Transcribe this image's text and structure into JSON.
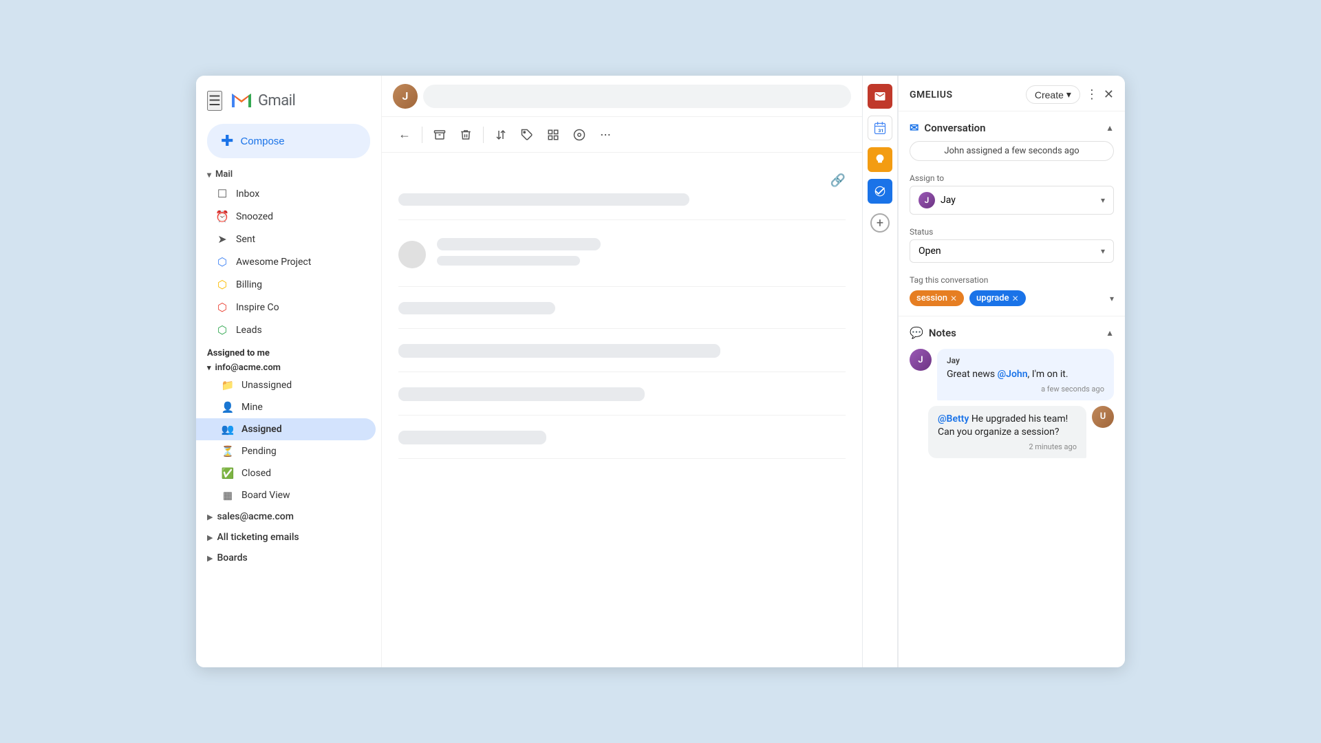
{
  "app": {
    "title": "Gmail",
    "search_placeholder": ""
  },
  "compose": {
    "label": "Compose",
    "plus": "+"
  },
  "sidebar": {
    "mail_section": "Mail",
    "mail_items": [
      {
        "id": "inbox",
        "label": "Inbox",
        "icon": "☐"
      },
      {
        "id": "snoozed",
        "label": "Snoozed",
        "icon": "🕐"
      },
      {
        "id": "sent",
        "label": "Sent",
        "icon": "➤"
      },
      {
        "id": "awesome-project",
        "label": "Awesome Project",
        "icon": "🔷"
      },
      {
        "id": "billing",
        "label": "Billing",
        "icon": "🔶"
      },
      {
        "id": "inspire-co",
        "label": "Inspire Co",
        "icon": "🟠"
      },
      {
        "id": "leads",
        "label": "Leads",
        "icon": "🟢"
      }
    ],
    "assigned_to_me": "Assigned to me",
    "info_email": "info@acme.com",
    "sub_items": [
      {
        "id": "unassigned",
        "label": "Unassigned",
        "icon": "📁"
      },
      {
        "id": "mine",
        "label": "Mine",
        "icon": "👤"
      },
      {
        "id": "assigned",
        "label": "Assigned",
        "icon": "👥"
      },
      {
        "id": "pending",
        "label": "Pending",
        "icon": "⏳"
      },
      {
        "id": "closed",
        "label": "Closed",
        "icon": "✅"
      },
      {
        "id": "board-view",
        "label": "Board View",
        "icon": "▦"
      }
    ],
    "collapsible_items": [
      {
        "id": "sales-email",
        "label": "sales@acme.com"
      },
      {
        "id": "all-ticketing",
        "label": "All ticketing emails"
      },
      {
        "id": "boards",
        "label": "Boards"
      }
    ]
  },
  "gmelius": {
    "title": "GMELIUS",
    "create_label": "Create",
    "three_dots": "⋮",
    "close": "✕"
  },
  "right_panel": {
    "conversation_section": {
      "title": "Conversation",
      "assigned_badge": "John assigned a few seconds ago",
      "assign_label": "Assign to",
      "assign_value": "Jay",
      "status_label": "Status",
      "status_value": "Open",
      "tag_label": "Tag this conversation",
      "tags": [
        {
          "label": "session",
          "color": "orange"
        },
        {
          "label": "upgrade",
          "color": "blue"
        }
      ]
    },
    "notes_section": {
      "title": "Notes",
      "notes": [
        {
          "author": "Jay",
          "text": "Great news @John, I'm on it.",
          "mention": "@John",
          "time": "a few seconds ago",
          "side": "left"
        },
        {
          "text": "@Betty He upgraded his team! Can you organize a session?",
          "mention": "@Betty",
          "time": "2 minutes ago",
          "side": "right"
        }
      ]
    }
  },
  "toolbar": {
    "back": "←",
    "archive": "📥",
    "delete": "🗑",
    "move": "📤",
    "label": "🏷",
    "more1": "⊞",
    "more2": "⊙",
    "dots": "⋮"
  }
}
